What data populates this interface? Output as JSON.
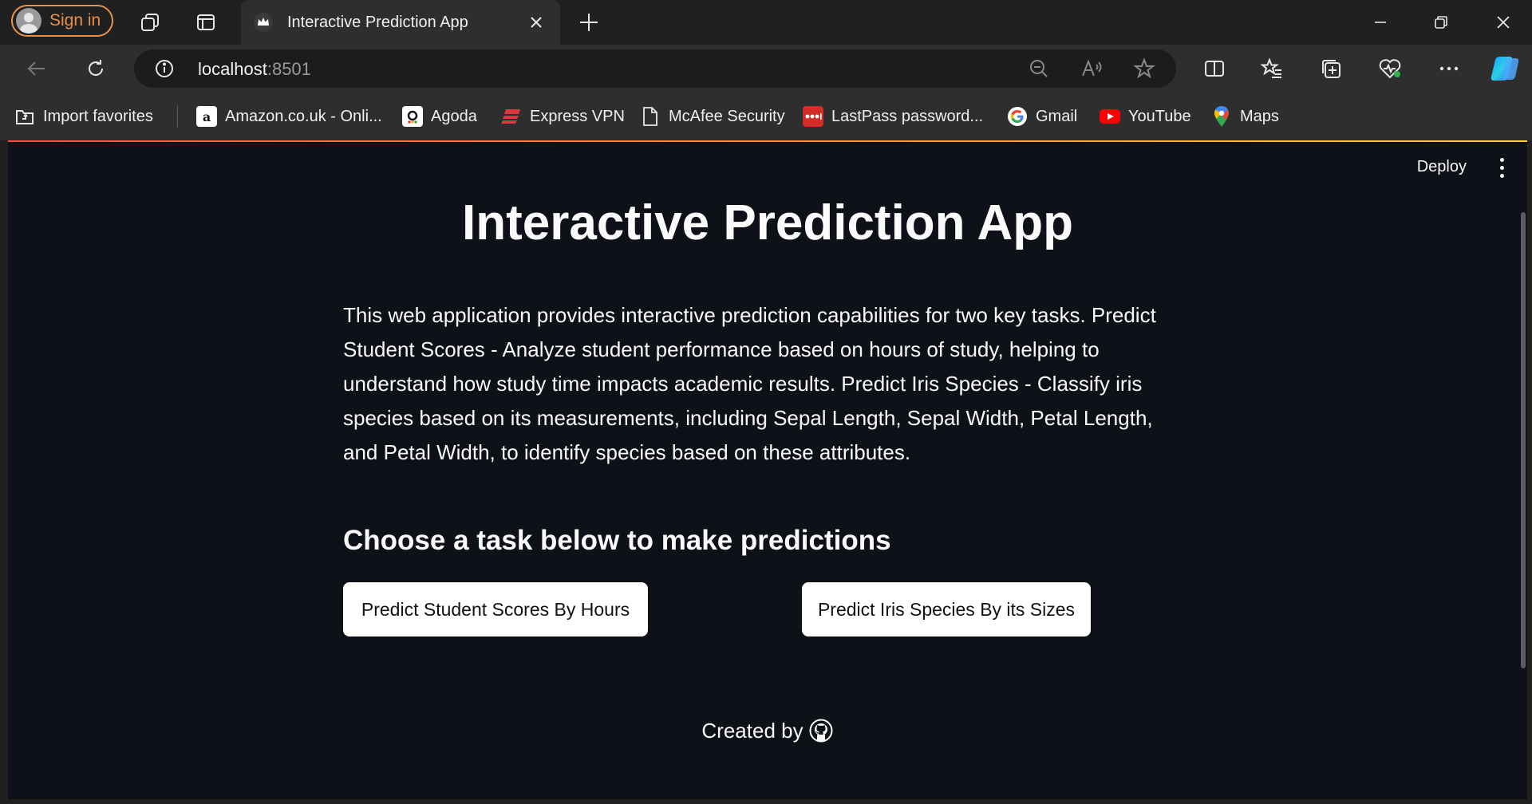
{
  "browser": {
    "signin_label": "Sign in",
    "tab": {
      "title": "Interactive Prediction App"
    },
    "address": {
      "host": "localhost",
      "port": ":8501"
    },
    "favorites": [
      {
        "label": "Import favorites",
        "icon": "import-icon"
      },
      {
        "label": "Amazon.co.uk - Onli...",
        "icon": "amazon-icon"
      },
      {
        "label": "Agoda",
        "icon": "agoda-icon"
      },
      {
        "label": "Express VPN",
        "icon": "expressvpn-icon"
      },
      {
        "label": "McAfee Security",
        "icon": "page-icon"
      },
      {
        "label": "LastPass password...",
        "icon": "lastpass-icon"
      },
      {
        "label": "Gmail",
        "icon": "google-icon"
      },
      {
        "label": "YouTube",
        "icon": "youtube-icon"
      },
      {
        "label": "Maps",
        "icon": "maps-icon"
      }
    ],
    "colors": {
      "signin_accent": "#e8914a",
      "chrome_bg": "#202020",
      "toolbar_bg": "#2e2e2e"
    }
  },
  "app": {
    "deploy_label": "Deploy",
    "title": "Interactive Prediction App",
    "description": "This web application provides interactive prediction capabilities for two key tasks. Predict Student Scores - Analyze student performance based on hours of study, helping to understand how study time impacts academic results. Predict Iris Species - Classify iris species based on its measurements, including Sepal Length, Sepal Width, Petal Length, and Petal Width, to identify species based on these attributes.",
    "subheading": "Choose a task below to make predictions",
    "buttons": {
      "student": "Predict Student Scores By Hours",
      "iris": "Predict Iris Species By its Sizes"
    },
    "footer": {
      "created_by": "Created by"
    },
    "colors": {
      "page_bg": "#0e1117",
      "text": "#fafafa",
      "button_bg": "#ffffff"
    }
  }
}
